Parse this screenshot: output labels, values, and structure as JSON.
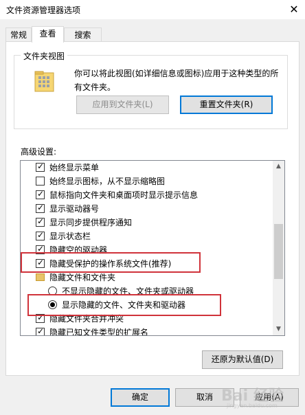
{
  "window": {
    "title": "文件资源管理器选项",
    "close_glyph": "✕"
  },
  "tabs": [
    {
      "label": "常规",
      "active": false
    },
    {
      "label": "查看",
      "active": true
    },
    {
      "label": "搜索",
      "active": false
    }
  ],
  "folder_views": {
    "label": "文件夹视图",
    "description": "你可以将此视图(如详细信息或图标)应用于这种类型的所有文件夹。",
    "apply_button": "应用到文件夹(L)",
    "reset_button": "重置文件夹(R)"
  },
  "advanced": {
    "label": "高级设置:",
    "items": [
      {
        "type": "checkbox",
        "checked": true,
        "text": "始终显示菜单"
      },
      {
        "type": "checkbox",
        "checked": false,
        "text": "始终显示图标，从不显示缩略图"
      },
      {
        "type": "checkbox",
        "checked": true,
        "text": "鼠标指向文件夹和桌面项时显示提示信息"
      },
      {
        "type": "checkbox",
        "checked": true,
        "text": "显示驱动器号"
      },
      {
        "type": "checkbox",
        "checked": true,
        "text": "显示同步提供程序通知"
      },
      {
        "type": "checkbox",
        "checked": true,
        "text": "显示状态栏"
      },
      {
        "type": "checkbox",
        "checked": true,
        "text": "隐藏空的驱动器"
      },
      {
        "type": "checkbox",
        "checked": true,
        "text": "隐藏受保护的操作系统文件(推荐)"
      },
      {
        "type": "folder",
        "text": "隐藏文件和文件夹"
      },
      {
        "type": "radio",
        "selected": false,
        "text": "不显示隐藏的文件、文件夹或驱动器"
      },
      {
        "type": "radio",
        "selected": true,
        "text": "显示隐藏的文件、文件夹和驱动器"
      },
      {
        "type": "checkbox",
        "checked": true,
        "text": "隐藏文件夹合并冲突"
      },
      {
        "type": "checkbox",
        "checked": true,
        "text": "隐藏已知文件类型的扩展名"
      }
    ]
  },
  "restore_button": "还原为默认值(D)",
  "dialog_buttons": {
    "ok": "确定",
    "cancel": "取消",
    "apply": "应用(A)"
  },
  "watermark": {
    "text": "Bai 经验",
    "sub": "jingyan.baidu.com"
  },
  "colors": {
    "highlight": "#d0323a",
    "accent": "#0078d7"
  }
}
